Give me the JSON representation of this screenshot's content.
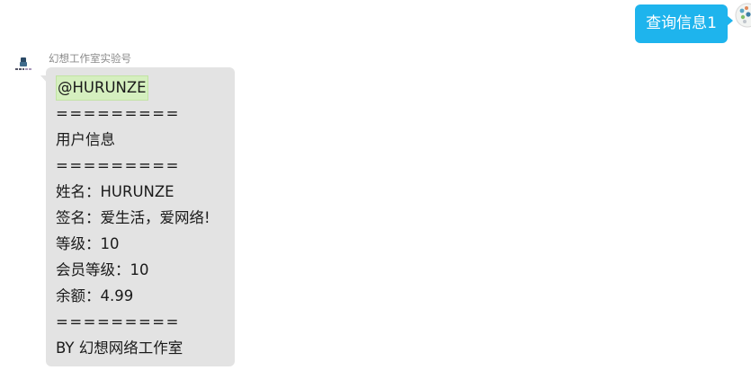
{
  "outgoing": {
    "text": "查询信息1",
    "color": "#1eb4ed"
  },
  "incoming": {
    "sender_name": "幻想工作室实验号",
    "bubble_color": "#e3e3e3",
    "mention": "@HURUNZE",
    "lines": {
      "sep1": "=========",
      "title": "用户信息",
      "sep2": "=========",
      "name": "姓名：HURUNZE",
      "signature": "签名：爱生活，爱网络!",
      "level": "等级：10",
      "vip_level": "会员等级：10",
      "balance": "余额：4.99",
      "sep3": "=========",
      "footer": "BY 幻想网络工作室"
    }
  },
  "icons": {
    "self_avatar": "user-avatar-icon",
    "bot_avatar": "bot-avatar-icon"
  }
}
